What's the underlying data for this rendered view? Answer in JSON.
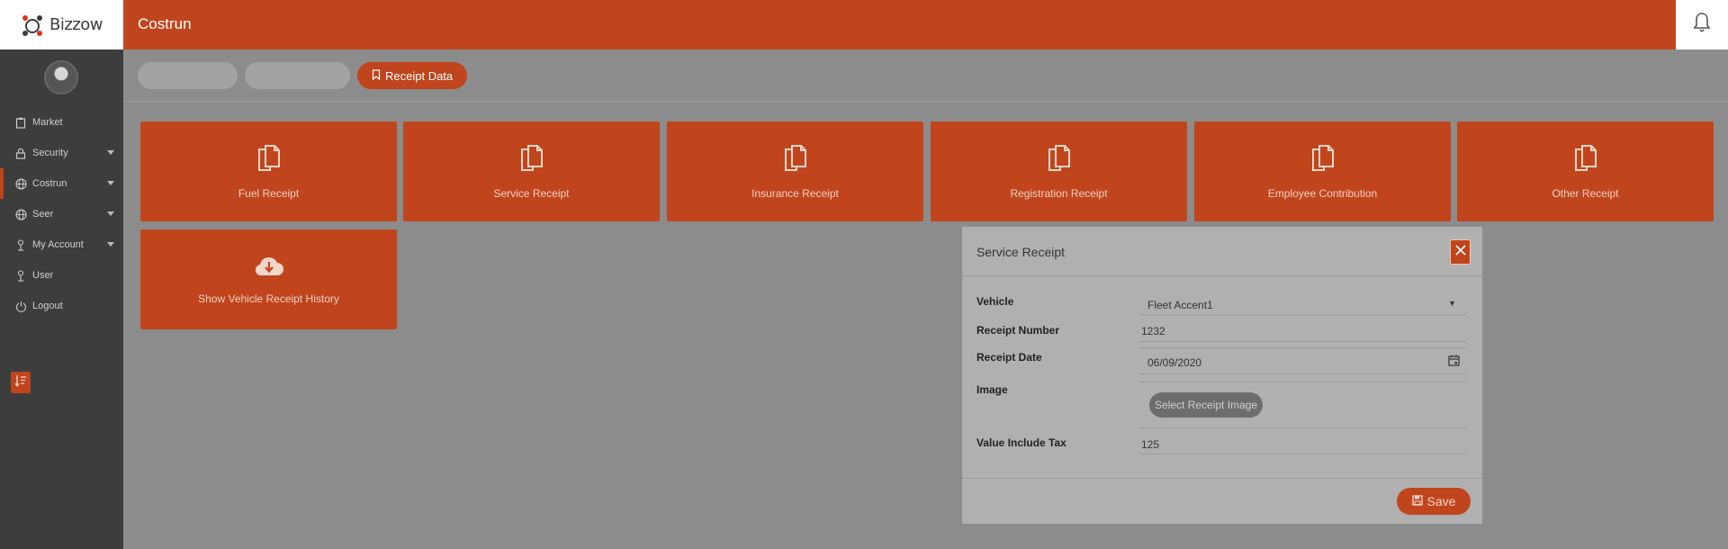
{
  "app": {
    "logo_text": "Bizzow",
    "title": "Costrun"
  },
  "sidebar": {
    "items": [
      {
        "label": "Market",
        "icon": "clipboard-icon",
        "caret": false,
        "active": false
      },
      {
        "label": "Security",
        "icon": "lock-icon",
        "caret": true,
        "active": false
      },
      {
        "label": "Costrun",
        "icon": "globe-icon",
        "caret": true,
        "active": true
      },
      {
        "label": "Seer",
        "icon": "globe-icon",
        "caret": true,
        "active": false
      },
      {
        "label": "My Account",
        "icon": "user-icon",
        "caret": true,
        "active": false
      },
      {
        "label": "User",
        "icon": "user-icon",
        "caret": false,
        "active": false
      },
      {
        "label": "Logout",
        "icon": "power-icon",
        "caret": false,
        "active": false
      }
    ]
  },
  "toolbar": {
    "tabs": [
      {
        "label": "",
        "style": "ghost"
      },
      {
        "label": "",
        "style": "ghost"
      },
      {
        "label": "Receipt Data",
        "style": "primary"
      }
    ]
  },
  "cards": [
    {
      "label": "Fuel Receipt",
      "icon": "documents-icon"
    },
    {
      "label": "Service Receipt",
      "icon": "documents-icon"
    },
    {
      "label": "Insurance Receipt",
      "icon": "documents-icon"
    },
    {
      "label": "Registration Receipt",
      "icon": "documents-icon"
    },
    {
      "label": "Employee Contribution",
      "icon": "documents-icon"
    },
    {
      "label": "Other Receipt",
      "icon": "documents-icon"
    },
    {
      "label": "Show Vehicle Receipt History",
      "icon": "cloud-download-icon"
    }
  ],
  "modal": {
    "title": "Service Receipt",
    "fields": {
      "vehicle_label": "Vehicle",
      "vehicle_value": "Fleet Accent1",
      "receipt_number_label": "Receipt Number",
      "receipt_number_value": "1232",
      "receipt_date_label": "Receipt Date",
      "receipt_date_value": "06/09/2020",
      "image_label": "Image",
      "image_button": "Select Receipt Image",
      "value_tax_label": "Value Include Tax",
      "value_tax_value": "125"
    },
    "save_label": "Save"
  },
  "colors": {
    "accent": "#c0451d",
    "sidebar": "#3d3d3d",
    "overlay_bg": "#8c8c8c"
  }
}
